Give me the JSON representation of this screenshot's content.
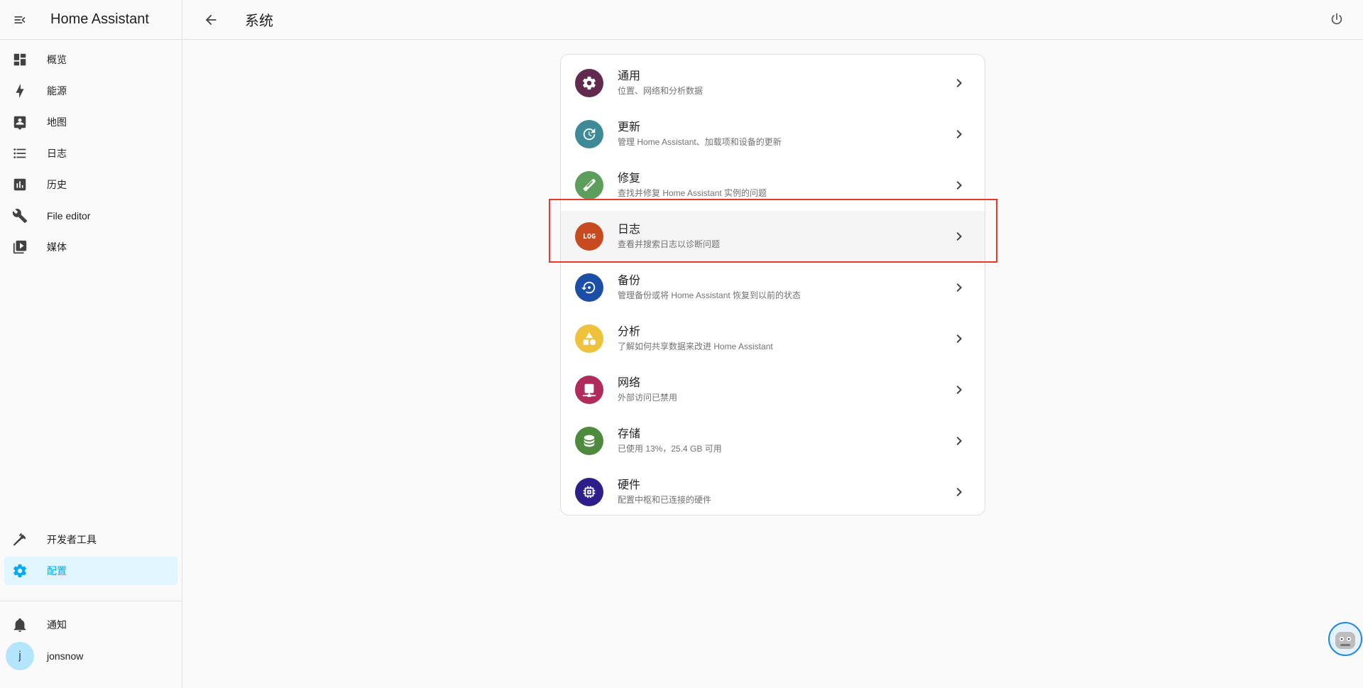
{
  "app": {
    "title": "Home Assistant"
  },
  "sidebar": {
    "items": [
      {
        "label": "概览",
        "icon": "dashboard-icon"
      },
      {
        "label": "能源",
        "icon": "lightning-icon"
      },
      {
        "label": "地图",
        "icon": "map-icon"
      },
      {
        "label": "日志",
        "icon": "list-icon"
      },
      {
        "label": "历史",
        "icon": "chart-icon"
      },
      {
        "label": "File editor",
        "icon": "wrench-icon"
      },
      {
        "label": "媒体",
        "icon": "media-icon"
      }
    ],
    "bottom": [
      {
        "label": "开发者工具",
        "icon": "hammer-icon"
      },
      {
        "label": "配置",
        "icon": "gear-icon",
        "active": true
      }
    ],
    "notifications": {
      "label": "通知",
      "icon": "bell-icon"
    },
    "user": {
      "name": "jonsnow",
      "initial": "j"
    }
  },
  "header": {
    "title": "系统"
  },
  "rows": [
    {
      "title": "通用",
      "subtitle": "位置、网络和分析数据",
      "color": "#632a4f",
      "icon": "gear-icon"
    },
    {
      "title": "更新",
      "subtitle": "管理 Home Assistant、加载项和设备的更新",
      "color": "#3e8a99",
      "icon": "update-icon"
    },
    {
      "title": "修复",
      "subtitle": "查找并修复 Home Assistant 实例的问题",
      "color": "#5c9e5c",
      "icon": "bandage-icon"
    },
    {
      "title": "日志",
      "subtitle": "查看并搜索日志以诊断问题",
      "color": "#c84b1f",
      "icon": "log-icon",
      "badge_text": "LOG",
      "highlighted": true
    },
    {
      "title": "备份",
      "subtitle": "管理备份或将 Home Assistant 恢复到以前的状态",
      "color": "#1b4fa5",
      "icon": "backup-icon"
    },
    {
      "title": "分析",
      "subtitle": "了解如何共享数据来改进 Home Assistant",
      "color": "#f0c23b",
      "icon": "shapes-icon"
    },
    {
      "title": "网络",
      "subtitle": "外部访问已禁用",
      "color": "#b02a5b",
      "icon": "network-icon"
    },
    {
      "title": "存储",
      "subtitle": "已使用 13%，25.4 GB 可用",
      "color": "#4e8a3d",
      "icon": "database-icon"
    },
    {
      "title": "硬件",
      "subtitle": "配置中枢和已连接的硬件",
      "color": "#2c1f8a",
      "icon": "chip-icon"
    }
  ]
}
